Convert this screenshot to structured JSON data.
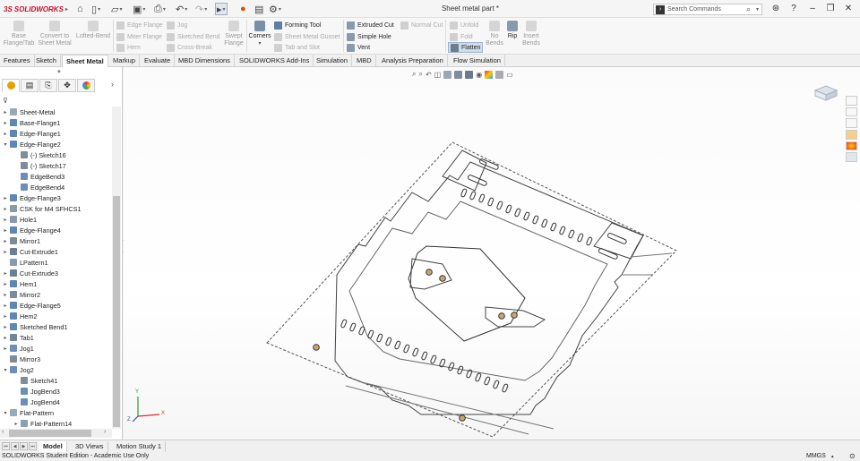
{
  "app": {
    "brand": "SOLIDWORKS",
    "document_title": "Sheet metal part *",
    "search_placeholder": "Search Commands"
  },
  "quick_access": {
    "icons": [
      "home-icon",
      "new-doc-icon",
      "open-icon",
      "save-icon",
      "print-icon",
      "undo-icon",
      "redo-icon",
      "select-icon",
      "rebuild-icon",
      "file-properties-icon",
      "options-icon"
    ]
  },
  "window_controls": {
    "icons": [
      "expand-icon",
      "help-icon",
      "minimize-icon",
      "restore-icon",
      "close-icon"
    ]
  },
  "ribbon": {
    "base_flange": "Base\nFlange/Tab",
    "convert": "Convert to\nSheet Metal",
    "lofted_bend": "Lofted-Bend",
    "edge_flange": "Edge Flange",
    "miter_flange": "Miter Flange",
    "hem": "Hem",
    "jog": "Jog",
    "sketched_bend": "Sketched Bend",
    "cross_break": "Cross-Break",
    "swept_flange": "Swept\nFlange",
    "corners": "Corners",
    "forming_tool": "Forming Tool",
    "sheet_metal_gusset": "Sheet Metal Gusset",
    "tab_and_slot": "Tab and Slot",
    "extruded_cut": "Extruded Cut",
    "simple_hole": "Simple Hole",
    "vent": "Vent",
    "normal_cut": "Normal Cut",
    "unfold": "Unfold",
    "fold": "Fold",
    "flatten": "Flatten",
    "no_bends": "No\nBends",
    "rip": "Rip",
    "insert_bends": "Insert\nBends"
  },
  "tabs": [
    "Features",
    "Sketch",
    "Sheet Metal",
    "Markup",
    "Evaluate",
    "MBD Dimensions",
    "SOLIDWORKS Add-Ins",
    "Simulation",
    "MBD",
    "Analysis Preparation",
    "Flow Simulation"
  ],
  "active_tab": "Sheet Metal",
  "feature_tree": [
    {
      "label": "Sheet-Metal",
      "indent": 0,
      "toggle": "▸",
      "icon": "folder"
    },
    {
      "label": "Base-Flange1",
      "indent": 0,
      "toggle": "▸",
      "icon": "feature"
    },
    {
      "label": "Edge-Flange1",
      "indent": 0,
      "toggle": "▸",
      "icon": "feature"
    },
    {
      "label": "Edge-Flange2",
      "indent": 0,
      "toggle": "▾",
      "icon": "feature"
    },
    {
      "label": "(-) Sketch16",
      "indent": 1,
      "toggle": "",
      "icon": "sketch"
    },
    {
      "label": "(-) Sketch17",
      "indent": 1,
      "toggle": "",
      "icon": "sketch"
    },
    {
      "label": "EdgeBend3",
      "indent": 1,
      "toggle": "",
      "icon": "bend"
    },
    {
      "label": "EdgeBend4",
      "indent": 1,
      "toggle": "",
      "icon": "bend"
    },
    {
      "label": "Edge-Flange3",
      "indent": 0,
      "toggle": "▸",
      "icon": "feature"
    },
    {
      "label": "CSK for M4 SFHCS1",
      "indent": 0,
      "toggle": "▸",
      "icon": "hole"
    },
    {
      "label": "Hole1",
      "indent": 0,
      "toggle": "▸",
      "icon": "hole"
    },
    {
      "label": "Edge-Flange4",
      "indent": 0,
      "toggle": "▸",
      "icon": "feature"
    },
    {
      "label": "Mirror1",
      "indent": 0,
      "toggle": "▸",
      "icon": "mirror"
    },
    {
      "label": "Cut-Extrude1",
      "indent": 0,
      "toggle": "▸",
      "icon": "cut"
    },
    {
      "label": "LPattern1",
      "indent": 0,
      "toggle": "",
      "icon": "pattern"
    },
    {
      "label": "Cut-Extrude3",
      "indent": 0,
      "toggle": "▸",
      "icon": "cut"
    },
    {
      "label": "Hem1",
      "indent": 0,
      "toggle": "▸",
      "icon": "feature"
    },
    {
      "label": "Mirror2",
      "indent": 0,
      "toggle": "▸",
      "icon": "mirror"
    },
    {
      "label": "Edge-Flange5",
      "indent": 0,
      "toggle": "▸",
      "icon": "feature"
    },
    {
      "label": "Hem2",
      "indent": 0,
      "toggle": "▸",
      "icon": "feature"
    },
    {
      "label": "Sketched Bend1",
      "indent": 0,
      "toggle": "▸",
      "icon": "feature"
    },
    {
      "label": "Tab1",
      "indent": 0,
      "toggle": "▸",
      "icon": "tab"
    },
    {
      "label": "Jog1",
      "indent": 0,
      "toggle": "▸",
      "icon": "bend"
    },
    {
      "label": "Mirror3",
      "indent": 0,
      "toggle": "",
      "icon": "mirror"
    },
    {
      "label": "Jog2",
      "indent": 0,
      "toggle": "▾",
      "icon": "bend"
    },
    {
      "label": "Sketch41",
      "indent": 1,
      "toggle": "",
      "icon": "sketch"
    },
    {
      "label": "JogBend3",
      "indent": 1,
      "toggle": "",
      "icon": "bend"
    },
    {
      "label": "JogBend4",
      "indent": 1,
      "toggle": "",
      "icon": "bend"
    },
    {
      "label": "Flat-Pattern",
      "indent": 0,
      "toggle": "▾",
      "icon": "folder"
    },
    {
      "label": "Flat-Pattern14",
      "indent": 1,
      "toggle": "▸",
      "icon": "flat"
    }
  ],
  "bottom_tabs": [
    "Model",
    "3D Views",
    "Motion Study 1"
  ],
  "status": {
    "left": "SOLIDWORKS Student Edition - Academic Use Only",
    "units": "MMGS"
  },
  "triad": {
    "x": "X",
    "y": "Y",
    "z": "Z"
  }
}
